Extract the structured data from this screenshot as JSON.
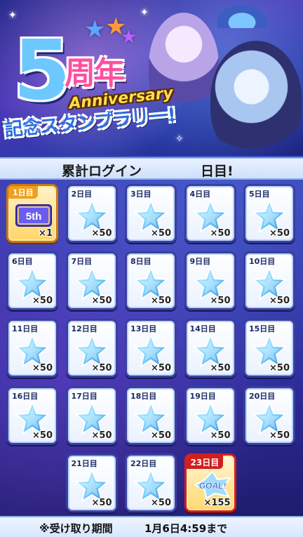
{
  "banner": {
    "logo_number": "5",
    "logo_kanji": "周年",
    "logo_anniversary": "Anniversary",
    "logo_subtitle": "記念スタンプラリー!"
  },
  "login_bar": {
    "label": "累計ログイン",
    "day_suffix": "日目!"
  },
  "stamps": [
    {
      "day": "1日目",
      "qty": "×1",
      "reward": "5th-ticket-icon",
      "state": "claimed"
    },
    {
      "day": "2日目",
      "qty": "×50",
      "reward": "star-gem-icon"
    },
    {
      "day": "3日目",
      "qty": "×50",
      "reward": "star-gem-icon"
    },
    {
      "day": "4日目",
      "qty": "×50",
      "reward": "star-gem-icon"
    },
    {
      "day": "5日目",
      "qty": "×50",
      "reward": "star-gem-icon"
    },
    {
      "day": "6日目",
      "qty": "×50",
      "reward": "star-gem-icon"
    },
    {
      "day": "7日目",
      "qty": "×50",
      "reward": "star-gem-icon"
    },
    {
      "day": "8日目",
      "qty": "×50",
      "reward": "star-gem-icon"
    },
    {
      "day": "9日目",
      "qty": "×50",
      "reward": "star-gem-icon"
    },
    {
      "day": "10日目",
      "qty": "×50",
      "reward": "star-gem-icon"
    },
    {
      "day": "11日目",
      "qty": "×50",
      "reward": "star-gem-icon"
    },
    {
      "day": "12日目",
      "qty": "×50",
      "reward": "star-gem-icon"
    },
    {
      "day": "13日目",
      "qty": "×50",
      "reward": "star-gem-icon"
    },
    {
      "day": "14日目",
      "qty": "×50",
      "reward": "star-gem-icon"
    },
    {
      "day": "15日目",
      "qty": "×50",
      "reward": "star-gem-icon"
    },
    {
      "day": "16日目",
      "qty": "×50",
      "reward": "star-gem-icon"
    },
    {
      "day": "17日目",
      "qty": "×50",
      "reward": "star-gem-icon"
    },
    {
      "day": "18日目",
      "qty": "×50",
      "reward": "star-gem-icon"
    },
    {
      "day": "19日目",
      "qty": "×50",
      "reward": "star-gem-icon"
    },
    {
      "day": "20日目",
      "qty": "×50",
      "reward": "star-gem-icon"
    },
    {
      "day": "21日目",
      "qty": "×50",
      "reward": "star-gem-icon"
    },
    {
      "day": "22日目",
      "qty": "×50",
      "reward": "star-gem-icon"
    },
    {
      "day": "23日目",
      "qty": "×155",
      "reward": "goal-badge-icon",
      "state": "goal",
      "badge_text": "GOAL!"
    }
  ],
  "footer": {
    "label": "※受け取り期間",
    "deadline": "1月6日4:59まで"
  },
  "ticket_text": "5th",
  "colors": {
    "gem_light": "#d9f6ff",
    "gem_mid": "#7fd4ff",
    "gem_dark": "#2f86d8",
    "goal_red": "#d11f1f",
    "claimed_gold": "#f0a020"
  }
}
